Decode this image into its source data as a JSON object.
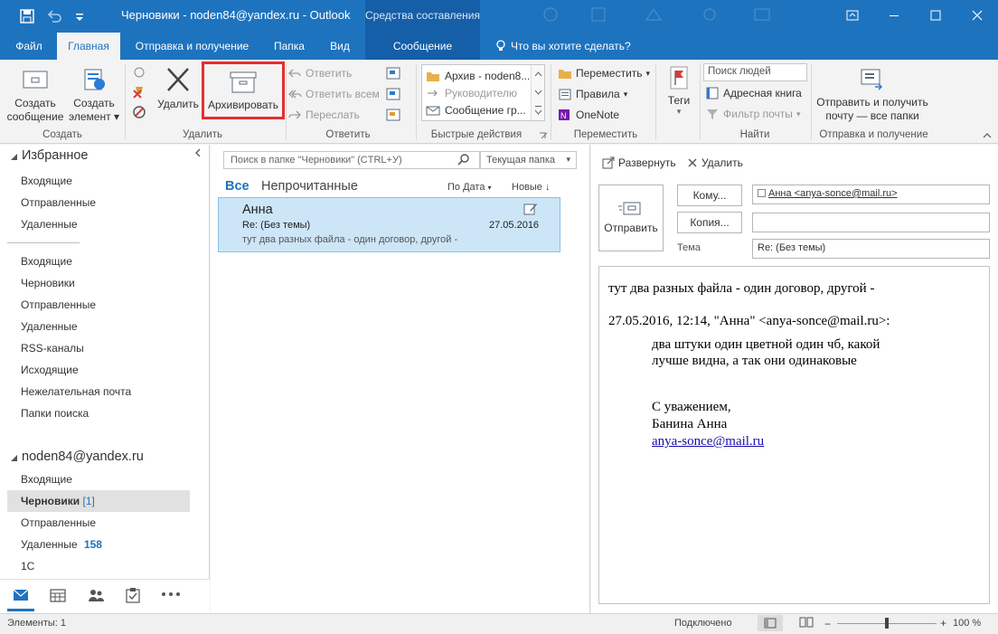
{
  "window": {
    "title": "Черновики - noden84@yandex.ru - Outlook",
    "context_tab_group": "Средства составления"
  },
  "ribbon_tabs": [
    "Файл",
    "Главная",
    "Отправка и получение",
    "Папка",
    "Вид",
    "Сообщение"
  ],
  "tell_me": "Что вы хотите сделать?",
  "ribbon": {
    "create": {
      "new_message": [
        "Создать",
        "сообщение"
      ],
      "new_item": [
        "Создать",
        "элемент"
      ],
      "group": "Создать"
    },
    "delete": {
      "delete": "Удалить",
      "archive": "Архивировать",
      "group": "Удалить"
    },
    "respond": {
      "reply": "Ответить",
      "reply_all": "Ответить всем",
      "forward": "Переслать",
      "group": "Ответить"
    },
    "quick_steps": {
      "items": [
        "Архив - noden8...",
        "Руководителю",
        "Сообщение гр..."
      ],
      "group": "Быстрые действия"
    },
    "move": {
      "move": "Переместить",
      "rules": "Правила",
      "onenote": "OneNote",
      "group": "Переместить"
    },
    "tags": {
      "label": "Теги"
    },
    "find": {
      "search_people": "Поиск людей",
      "address_book": "Адресная книга",
      "filter_mail": "Фильтр почты",
      "group": "Найти"
    },
    "send_receive": {
      "label": [
        "Отправить и получить",
        "почту — все папки"
      ],
      "group": "Отправка и получение"
    }
  },
  "nav": {
    "favorites_header": "Избранное",
    "favorites": [
      "Входящие",
      "Отправленные",
      "Удаленные"
    ],
    "folders": [
      "Входящие",
      "Черновики",
      "Отправленные",
      "Удаленные",
      "RSS-каналы",
      "Исходящие",
      "Нежелательная почта",
      "Папки поиска"
    ],
    "account_header": "noden84@yandex.ru",
    "account_folders": [
      {
        "name": "Входящие",
        "count": ""
      },
      {
        "name": "Черновики",
        "count": "[1]"
      },
      {
        "name": "Отправленные",
        "count": ""
      },
      {
        "name": "Удаленные",
        "count": "158"
      },
      {
        "name": "1С",
        "count": ""
      }
    ]
  },
  "list": {
    "search_placeholder": "Поиск в папке \"Черновики\" (CTRL+У)",
    "scope": "Текущая папка",
    "filter_all": "Все",
    "filter_unread": "Непрочитанные",
    "sort": "По Дата",
    "order": "Новые",
    "messages": [
      {
        "sender": "Анна",
        "subject": "Re: (Без темы)",
        "date": "27.05.2016",
        "preview": "тут два разных файла - один договор, другой -"
      }
    ]
  },
  "reading": {
    "expand": "Развернуть",
    "delete": "Удалить",
    "send": "Отправить",
    "to_button": "Кому...",
    "to_value": "Анна <anya-sonce@mail.ru>",
    "cc_button": "Копия...",
    "cc_value": "",
    "subject_label": "Тема",
    "subject_value": "Re: (Без темы)",
    "body": {
      "line1": "тут два разных файла - один договор, другой -",
      "quote_header": "27.05.2016, 12:14, \"Анна\" <anya-sonce@mail.ru>:",
      "quote_line1": "два штуки один цветной один чб, какой",
      "quote_line2": "лучше видна, а так они одинаковые",
      "sign1": "С уважением,",
      "sign2": "Банина Анна",
      "sign_email": "anya-sonce@mail.ru"
    }
  },
  "status": {
    "items": "Элементы: 1",
    "connection": "Подключено",
    "zoom": "100 %",
    "zoom_level": 0.5
  },
  "colors": {
    "brand": "#1e73be",
    "highlight": "#cde6f7",
    "callout": "#e03030"
  }
}
